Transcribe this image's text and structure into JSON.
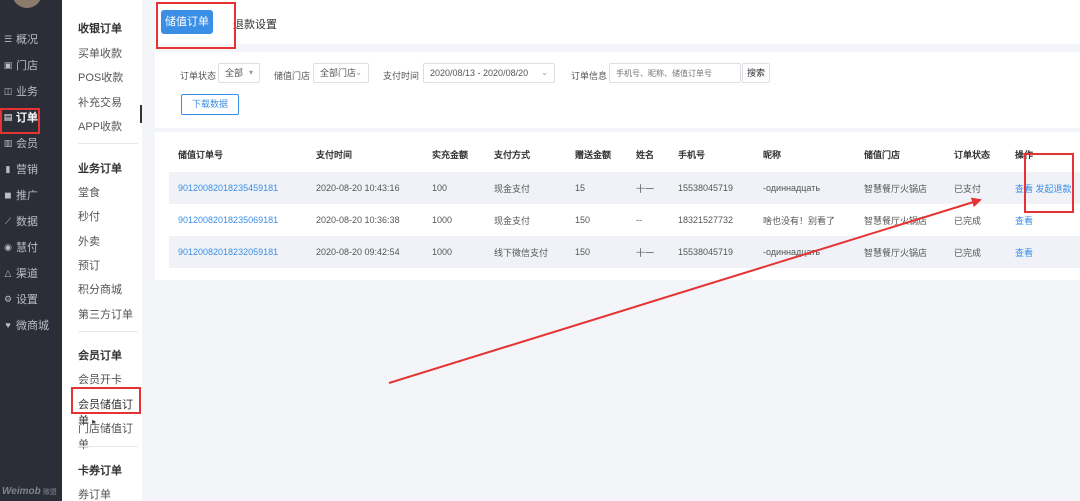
{
  "nav": {
    "items": [
      {
        "label": "概况",
        "icon": "list-icon"
      },
      {
        "label": "门店",
        "icon": "store-icon"
      },
      {
        "label": "业务",
        "icon": "briefcase-icon"
      },
      {
        "label": "订单",
        "icon": "order-icon"
      },
      {
        "label": "会员",
        "icon": "member-icon"
      },
      {
        "label": "营销",
        "icon": "chart-icon"
      },
      {
        "label": "推广",
        "icon": "promote-icon"
      },
      {
        "label": "数据",
        "icon": "data-icon"
      },
      {
        "label": "慧付",
        "icon": "pay-icon"
      },
      {
        "label": "渠道",
        "icon": "channel-icon"
      },
      {
        "label": "设置",
        "icon": "gear-icon"
      },
      {
        "label": "微商城",
        "icon": "mall-icon"
      }
    ],
    "active": "订单",
    "brand": "Weimob",
    "brand_sub": "微盟"
  },
  "subnav": {
    "groups": [
      {
        "title": "收银订单",
        "items": [
          "买单收款",
          "POS收款",
          "补充交易",
          "APP收款"
        ]
      },
      {
        "title": "业务订单",
        "items": [
          "堂食",
          "秒付",
          "外卖",
          "预订",
          "积分商城",
          "第三方订单"
        ]
      },
      {
        "title": "会员订单",
        "items": [
          "会员开卡",
          "会员储值订单",
          "门店储值订单"
        ]
      },
      {
        "title": "卡券订单",
        "items": [
          "券订单"
        ]
      }
    ],
    "active_item": "会员储值订单"
  },
  "tabs": {
    "active": "储值订单",
    "other": "退款设置"
  },
  "filters": {
    "status_label": "订单状态",
    "status_value": "全部",
    "store_label": "储值门店",
    "store_value": "全部门店",
    "time_label": "支付时间",
    "time_value": "2020/08/13 - 2020/08/20",
    "info_label": "订单信息",
    "info_placeholder": "手机号、昵称、储值订单号",
    "search_label": "搜索",
    "download_label": "下载数据"
  },
  "table": {
    "columns": [
      "储值订单号",
      "支付时间",
      "实充金额",
      "支付方式",
      "赠送金额",
      "姓名",
      "手机号",
      "昵称",
      "储值门店",
      "订单状态",
      "操作"
    ],
    "rows": [
      {
        "order_no": "90120082018235459181",
        "time": "2020-08-20 10:43:16",
        "amount": "100",
        "method": "现金支付",
        "gift": "15",
        "name": "十一",
        "phone": "15538045719",
        "nickname": "-одиннадцать",
        "store": "智慧餐厅火锅店",
        "status": "已支付",
        "action_view": "查看",
        "action_refund": "发起退款"
      },
      {
        "order_no": "90120082018235069181",
        "time": "2020-08-20 10:36:38",
        "amount": "1000",
        "method": "现金支付",
        "gift": "150",
        "name": "--",
        "phone": "18321527732",
        "nickname": "啥也没有！别看了",
        "store": "智慧餐厅火锅店",
        "status": "已完成",
        "action_view": "查看",
        "action_refund": ""
      },
      {
        "order_no": "90120082018232059181",
        "time": "2020-08-20 09:42:54",
        "amount": "1000",
        "method": "线下微信支付",
        "gift": "150",
        "name": "十一",
        "phone": "15538045719",
        "nickname": "-одиннадцать",
        "store": "智慧餐厅火锅店",
        "status": "已完成",
        "action_view": "查看",
        "action_refund": ""
      }
    ]
  },
  "colors": {
    "accent": "#3a8ee6",
    "annotation": "#e53333",
    "nav_bg": "#2b2e36"
  }
}
